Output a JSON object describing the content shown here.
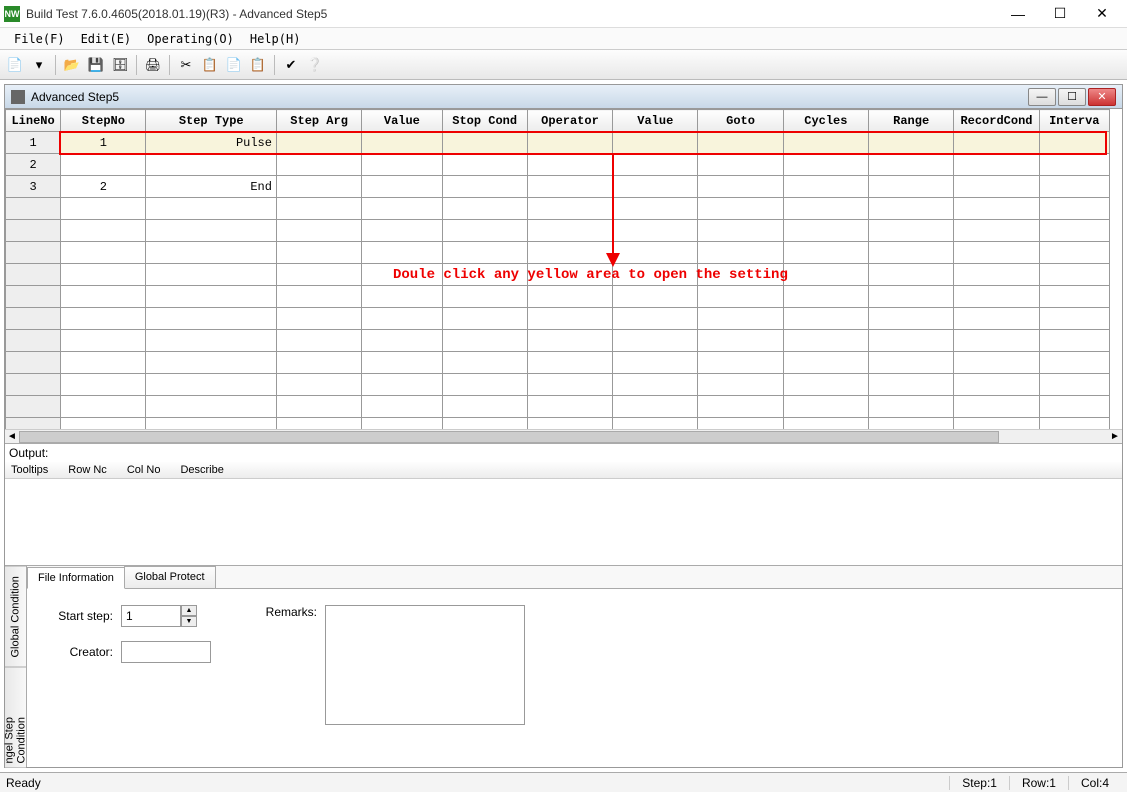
{
  "title": "Build Test  7.6.0.4605(2018.01.19)(R3) - Advanced Step5",
  "menu": {
    "file": "File(F)",
    "edit": "Edit(E)",
    "operating": "Operating(O)",
    "help": "Help(H)"
  },
  "subwindow": {
    "title": "Advanced Step5"
  },
  "grid": {
    "headers": [
      "LineNo",
      "StepNo",
      "Step Type",
      "Step Arg",
      "Value",
      "Stop Cond",
      "Operator",
      "Value",
      "Goto",
      "Cycles",
      "Range",
      "RecordCond",
      "Interva"
    ],
    "rows": [
      {
        "lineNo": "1",
        "stepNo": "1",
        "stepType": "Pulse"
      },
      {
        "lineNo": "2",
        "stepNo": "",
        "stepType": ""
      },
      {
        "lineNo": "3",
        "stepNo": "2",
        "stepType": "End"
      }
    ]
  },
  "hint": "Doule click any yellow area to open the setting",
  "output": {
    "label": "Output:",
    "cols": {
      "tooltips": "Tooltips",
      "rowno": "Row Nc",
      "colno": "Col No",
      "describe": "Describe"
    }
  },
  "sideTabs": {
    "global": "Global Condition",
    "channel": "ngel Step Condition"
  },
  "tabs": {
    "fileInfo": "File Information",
    "globalProtect": "Global Protect"
  },
  "form": {
    "startStepLabel": "Start step:",
    "startStepValue": "1",
    "creatorLabel": "Creator:",
    "creatorValue": "",
    "remarksLabel": "Remarks:",
    "remarksValue": ""
  },
  "status": {
    "ready": "Ready",
    "step": "Step:1",
    "row": "Row:1",
    "col": "Col:4"
  }
}
